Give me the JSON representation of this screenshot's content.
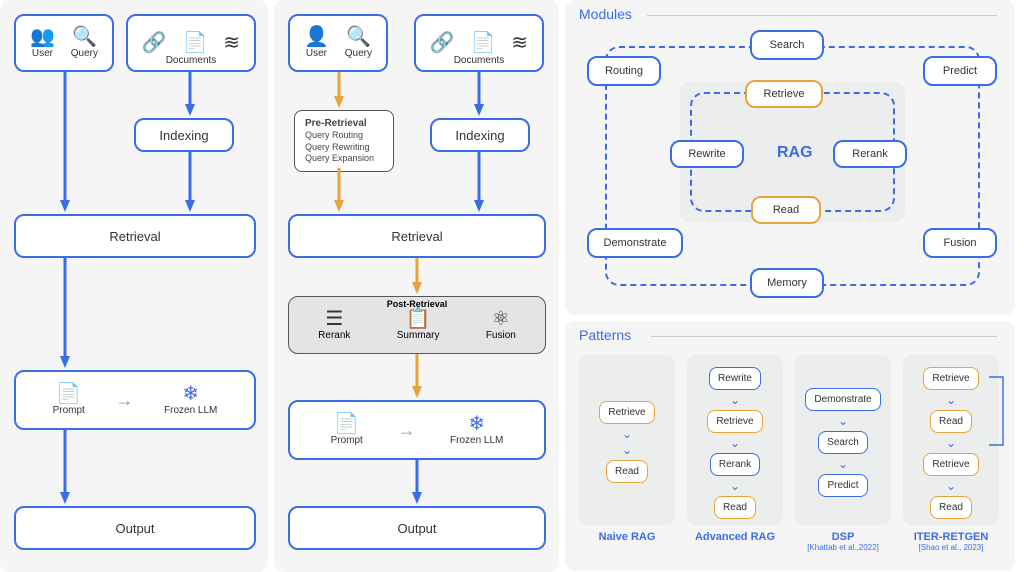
{
  "col1": {
    "user": "User",
    "query": "Query",
    "documents": "Documents",
    "indexing": "Indexing",
    "retrieval": "Retrieval",
    "prompt": "Prompt",
    "frozen": "Frozen LLM",
    "output": "Output"
  },
  "col2": {
    "user": "User",
    "query": "Query",
    "documents": "Documents",
    "pre_h": "Pre-Retrieval",
    "pre1": "Query Routing",
    "pre2": "Query Rewriting",
    "pre3": "Query Expansion",
    "indexing": "Indexing",
    "retrieval": "Retrieval",
    "post_h": "Post-Retrieval",
    "rerank": "Rerank",
    "summary": "Summary",
    "fusion": "Fusion",
    "prompt": "Prompt",
    "frozen": "Frozen LLM",
    "output": "Output"
  },
  "modules": {
    "title": "Modules",
    "routing": "Routing",
    "search": "Search",
    "predict": "Predict",
    "retrieve": "Retrieve",
    "rewrite": "Rewrite",
    "rag": "RAG",
    "rerank": "Rerank",
    "read": "Read",
    "demonstrate": "Demonstrate",
    "memory": "Memory",
    "fusion": "Fusion"
  },
  "patterns": {
    "title": "Patterns",
    "naive": {
      "label": "Naive RAG",
      "s0": "Retrieve",
      "s1": "Read"
    },
    "adv": {
      "label": "Advanced RAG",
      "s0": "Rewrite",
      "s1": "Retrieve",
      "s2": "Rerank",
      "s3": "Read"
    },
    "dsp": {
      "label": "DSP",
      "sub": "[Khattab et al.,2022]",
      "s0": "Demonstrate",
      "s1": "Search",
      "s2": "Predict"
    },
    "iter": {
      "label": "ITER-RETGEN",
      "sub": "[Shao et al., 2023]",
      "s0": "Retrieve",
      "s1": "Read",
      "s2": "Retrieve",
      "s3": "Read"
    }
  }
}
